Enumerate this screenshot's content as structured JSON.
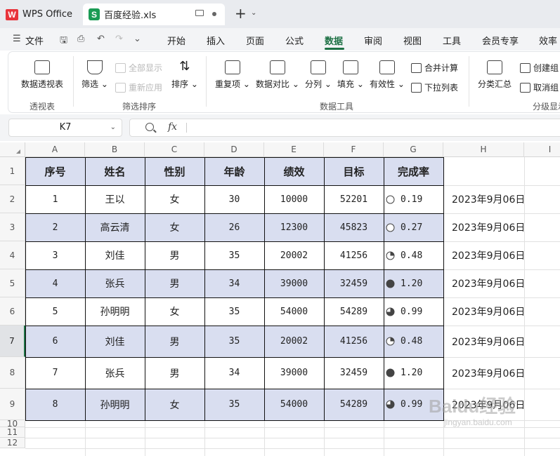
{
  "titlebar": {
    "app_name": "WPS Office",
    "doc_tab": "百度经验.xls",
    "new_tab": "+"
  },
  "menu": {
    "file": "文件",
    "tabs": [
      "开始",
      "插入",
      "页面",
      "公式",
      "数据",
      "审阅",
      "视图",
      "工具",
      "会员专享",
      "效率"
    ],
    "active_tab": "数据"
  },
  "ribbon": {
    "pivot": "数据透视表",
    "filter": "筛选",
    "show_all": "全部显示",
    "reapply": "重新应用",
    "sort": "排序",
    "duplicates": "重复项",
    "compare": "数据对比",
    "split": "分列",
    "fill": "填充",
    "validity": "有效性",
    "merge_calc": "合并计算",
    "dropdown_list": "下拉列表",
    "subtotal": "分类汇总",
    "create_group": "创建组",
    "ungroup": "取消组",
    "group_pivot": "透视表",
    "group_filter_sort": "筛选排序",
    "group_data_tools": "数据工具",
    "group_outline": "分级显示"
  },
  "formula_bar": {
    "name_box": "K7",
    "fx_label": "fx",
    "formula": ""
  },
  "columns": [
    "A",
    "B",
    "C",
    "D",
    "E",
    "F",
    "G",
    "H",
    "I"
  ],
  "rows": [
    "1",
    "2",
    "3",
    "4",
    "5",
    "6",
    "7",
    "8",
    "9",
    "10",
    "11",
    "12"
  ],
  "table": {
    "headers": [
      "序号",
      "姓名",
      "性别",
      "年龄",
      "绩效",
      "目标",
      "完成率"
    ],
    "rows": [
      [
        "1",
        "王以",
        "女",
        "30",
        "10000",
        "52201",
        "0.19"
      ],
      [
        "2",
        "高云清",
        "女",
        "26",
        "12300",
        "45823",
        "0.27"
      ],
      [
        "3",
        "刘佳",
        "男",
        "35",
        "20002",
        "41256",
        "0.48"
      ],
      [
        "4",
        "张兵",
        "男",
        "34",
        "39000",
        "32459",
        "1.20"
      ],
      [
        "5",
        "孙明明",
        "女",
        "35",
        "54000",
        "54289",
        "0.99"
      ],
      [
        "6",
        "刘佳",
        "男",
        "35",
        "20002",
        "41256",
        "0.48"
      ],
      [
        "7",
        "张兵",
        "男",
        "34",
        "39000",
        "32459",
        "1.20"
      ],
      [
        "8",
        "孙明明",
        "女",
        "35",
        "54000",
        "54289",
        "0.99"
      ]
    ],
    "pie_fill_quarters": [
      0,
      0,
      1,
      4,
      3,
      1,
      4,
      3
    ],
    "dates": [
      "2023年9月06日",
      "2023年9月06日",
      "2023年9月06日",
      "2023年9月06日",
      "2023年9月06日",
      "2023年9月06日",
      "2023年9月06日",
      "2023年9月06日"
    ]
  },
  "selected_row": "7",
  "colors": {
    "band": "#d9def0",
    "accent_green": "#1e7145",
    "wps_red": "#e8343b"
  },
  "watermark": "Baidu经验",
  "watermark_sub": "jingyan.baidu.com"
}
